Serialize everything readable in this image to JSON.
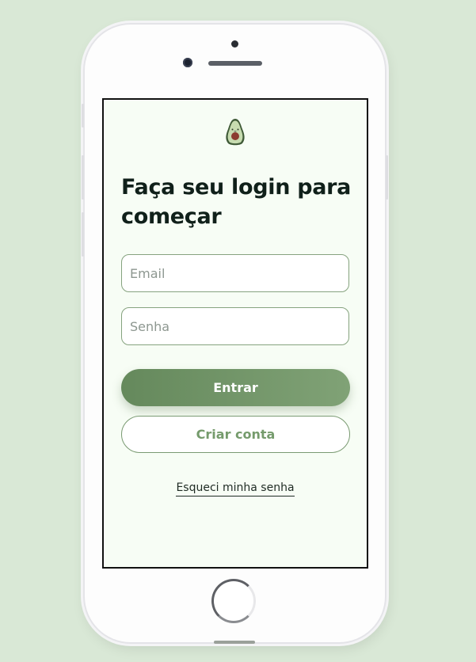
{
  "login": {
    "title": "Faça seu login para começar",
    "email_placeholder": "Email",
    "password_placeholder": "Senha",
    "submit_label": "Entrar",
    "create_account_label": "Criar conta",
    "forgot_password_label": "Esqueci minha senha"
  },
  "icons": {
    "logo": "avocado-icon"
  },
  "colors": {
    "background": "#d9e8d6",
    "screen": "#f7fdf5",
    "primary": "#6f9466",
    "primary_text": "#ffffff",
    "heading": "#10201a"
  }
}
